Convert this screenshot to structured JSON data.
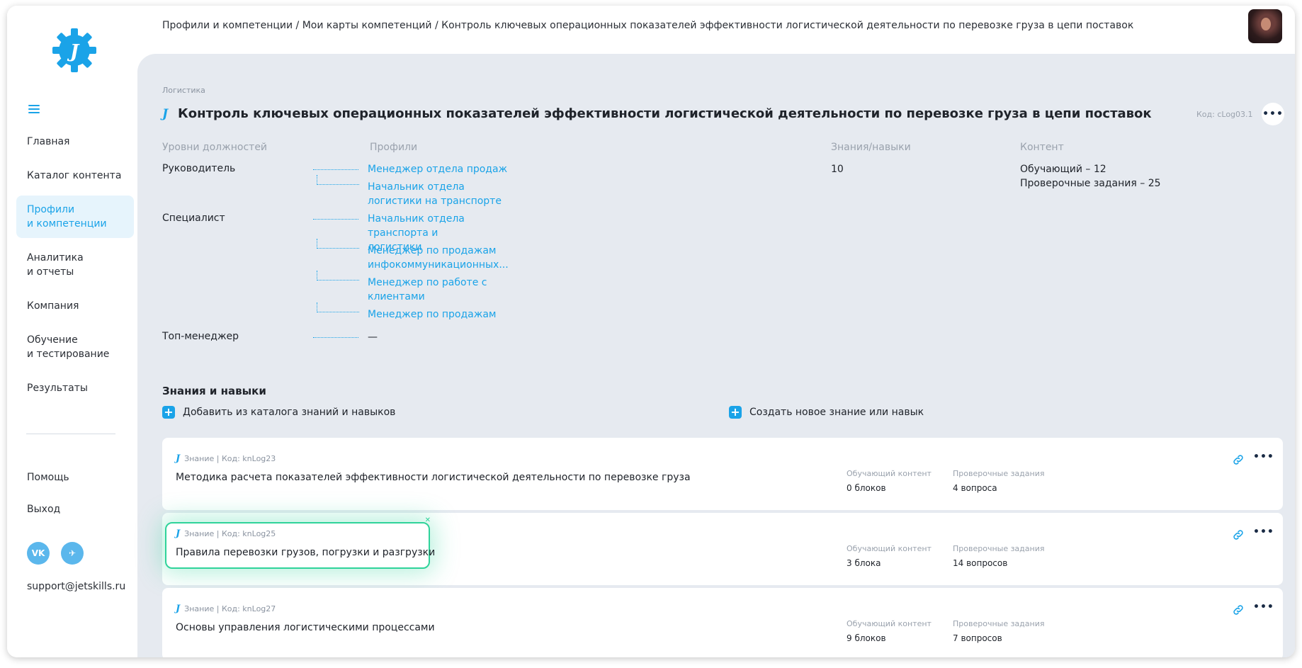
{
  "breadcrumb": {
    "items": [
      "Профили и компетенции",
      "Мои карты компетенций",
      "Контроль ключевых операционных показателей эффективности логистической деятельности по перевозке груза в цепи поставок"
    ],
    "sep": " / "
  },
  "sidebar": {
    "menu": [
      {
        "label": "Главная"
      },
      {
        "label": "Каталог контента"
      },
      {
        "label": "Профили\nи компетенции"
      },
      {
        "label": "Аналитика\nи отчеты"
      },
      {
        "label": "Компания"
      },
      {
        "label": "Обучение\nи тестирование"
      },
      {
        "label": "Результаты"
      }
    ],
    "help": "Помощь",
    "logout": "Выход",
    "social": {
      "vk": "VK",
      "tg": "✈"
    },
    "support_email": "support@jetskills.ru"
  },
  "competency": {
    "category": "Логистика",
    "title": "Контроль ключевых операционных показателей эффективности логистической деятельности по перевозке груза в цепи поставок",
    "code": "Код: cLog03.1",
    "logo_mark": "J"
  },
  "columns": {
    "levels": "Уровни должностей",
    "profiles": "Профили",
    "skills": "Знания/навыки",
    "content": "Контент"
  },
  "levels": [
    {
      "name": "Руководитель",
      "profiles": [
        "Менеджер отдела продаж",
        "Начальник отдела логистики на транспорте"
      ]
    },
    {
      "name": "Специалист",
      "profiles": [
        "Начальник отдела транспорта и логистики",
        "Менеджер по продажам инфокоммуникационных...",
        "Менеджер по работе с клиентами",
        "Менеджер по продажам"
      ]
    },
    {
      "name": "Топ-менеджер",
      "profiles": [
        "—"
      ]
    }
  ],
  "skills_count": "10",
  "content_stats": {
    "learning": "Обучающий – 12",
    "tests": "Проверочные задания – 25"
  },
  "skills_section": {
    "title": "Знания и навыки",
    "add_from_catalog": "Добавить из каталога знаний и навыков",
    "create_new": "Создать новое знание или навык"
  },
  "cards": [
    {
      "meta": "Знание | Код: knLog23",
      "name": "Методика расчета показателей эффективности логистической деятельности по перевозке груза",
      "learning_label": "Обучающий контент",
      "learning_value": "0 блоков",
      "tests_label": "Проверочные задания",
      "tests_value": "4 вопроса"
    },
    {
      "meta": "Знание | Код: knLog25",
      "name": "Правила перевозки грузов, погрузки и разгрузки",
      "learning_label": "Обучающий контент",
      "learning_value": "3 блока",
      "tests_label": "Проверочные задания",
      "tests_value": "14 вопросов"
    },
    {
      "meta": "Знание | Код: knLog27",
      "name": "Основы управления логистическими процессами",
      "learning_label": "Обучающий контент",
      "learning_value": "9 блоков",
      "tests_label": "Проверочные задания",
      "tests_value": "7 вопросов"
    }
  ],
  "colors": {
    "accent": "#1aa3e8",
    "highlight": "#2fd39a",
    "main_bg": "#e6eaf0"
  },
  "icons": [
    "gear-logo-icon",
    "hamburger-icon",
    "vk-icon",
    "telegram-icon",
    "link-icon",
    "more-dots-icon",
    "plus-icon"
  ]
}
